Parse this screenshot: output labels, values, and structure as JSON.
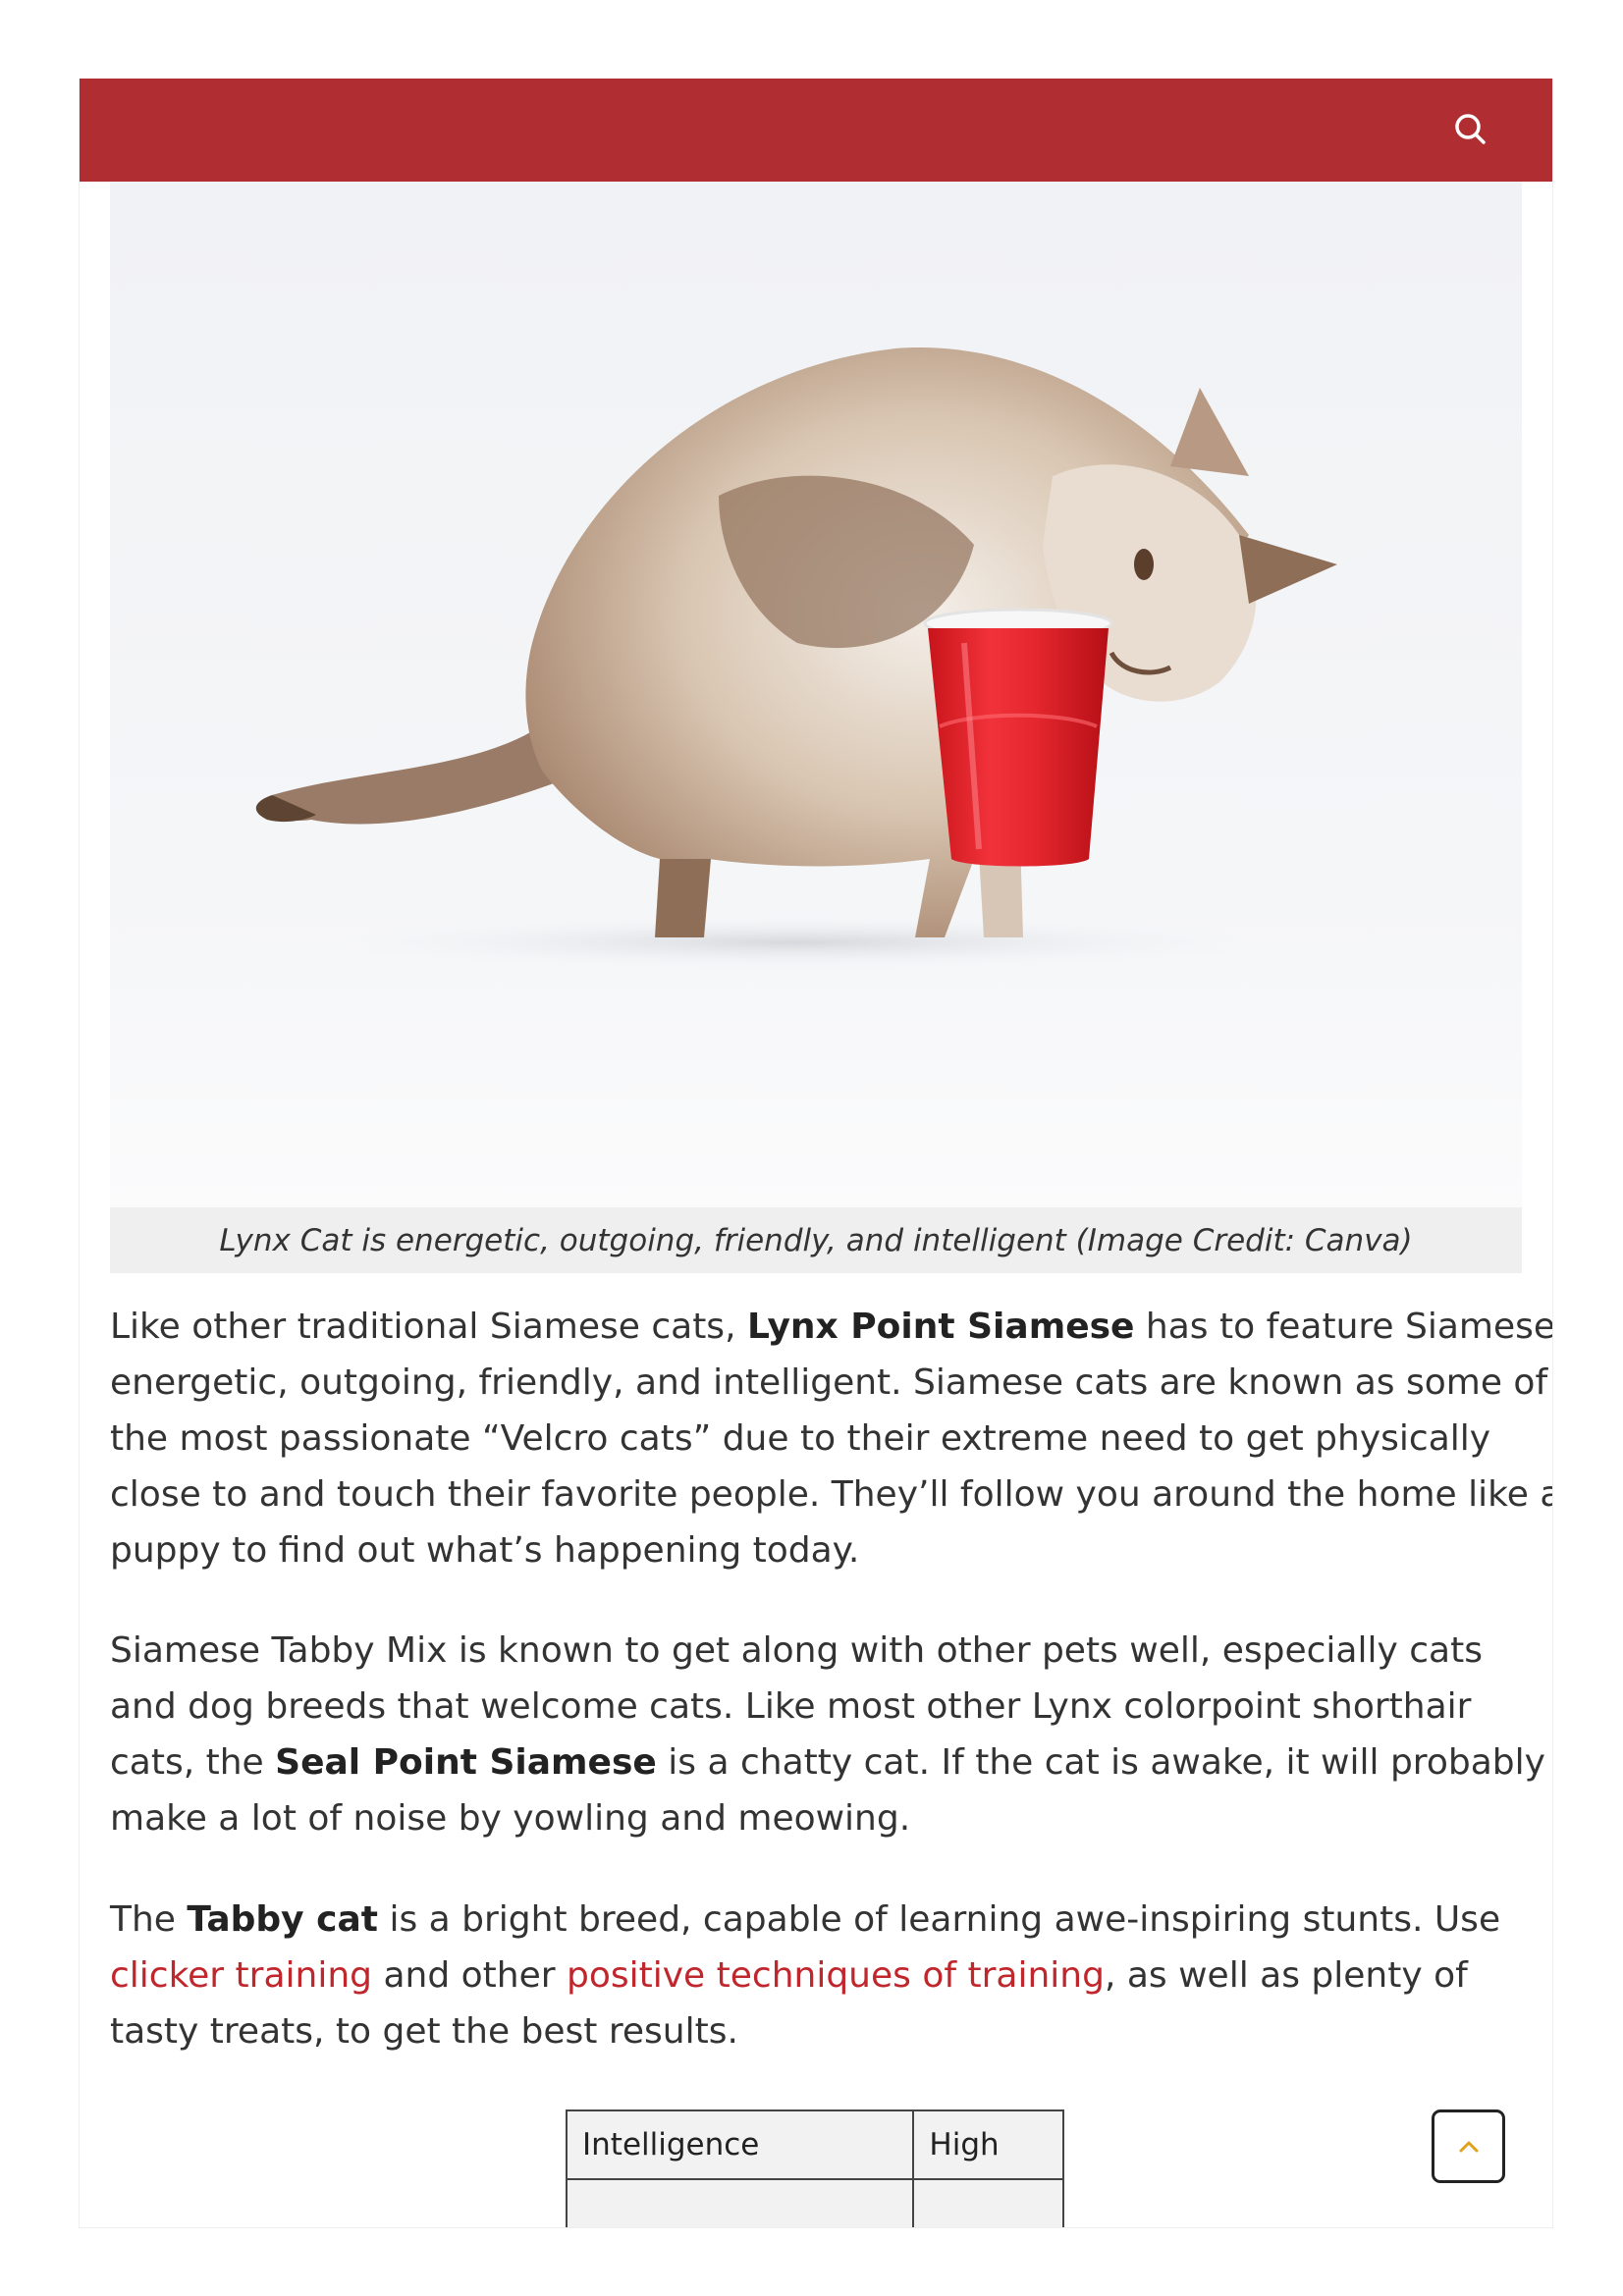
{
  "header": {
    "search_icon": "search-icon",
    "color": "#b02d31"
  },
  "figure": {
    "caption": "Lynx Cat is energetic, outgoing, friendly, and intelligent (Image Credit: Canva)"
  },
  "article": {
    "p1": {
      "l1_pre": "Like other traditional Siamese cats, ",
      "l1_bold": "Lynx Point Siamese",
      "l1_post": " has to feature Siamese as",
      "l2": "energetic, outgoing, friendly, and intelligent. Siamese cats are known as some of",
      "l3": "the most passionate “Velcro cats” due to their extreme need to get physically",
      "l4": "close to and touch their favorite people. They’ll follow you around the home like a",
      "l5": "puppy to find out what’s happening today."
    },
    "p2": {
      "l1": "Siamese Tabby Mix is known to get along with other pets well, especially cats",
      "l2": "and dog breeds that welcome cats. Like most other Lynx colorpoint shorthair",
      "l3_pre": "cats, the ",
      "l3_bold": "Seal Point Siamese",
      "l3_post": " is a chatty cat. If the cat is awake, it will probably",
      "l4": "make a lot of noise by yowling and meowing."
    },
    "p3": {
      "l1_pre": "The ",
      "l1_bold": "Tabby cat",
      "l1_post": " is a bright breed, capable of learning awe-inspiring stunts. Use",
      "l2_link1": "clicker training",
      "l2_mid": " and other ",
      "l2_link2": "positive techniques of training",
      "l2_post": ", as well as plenty of",
      "l3": "tasty treats, to get the best results."
    },
    "link_color": "#c0272d"
  },
  "stats_table": {
    "rows": [
      {
        "label": "Intelligence",
        "value": "High"
      },
      {
        "label": "",
        "value": ""
      }
    ]
  },
  "scroll_top": {
    "icon": "chevron-up-icon",
    "color": "#e0a21b"
  }
}
